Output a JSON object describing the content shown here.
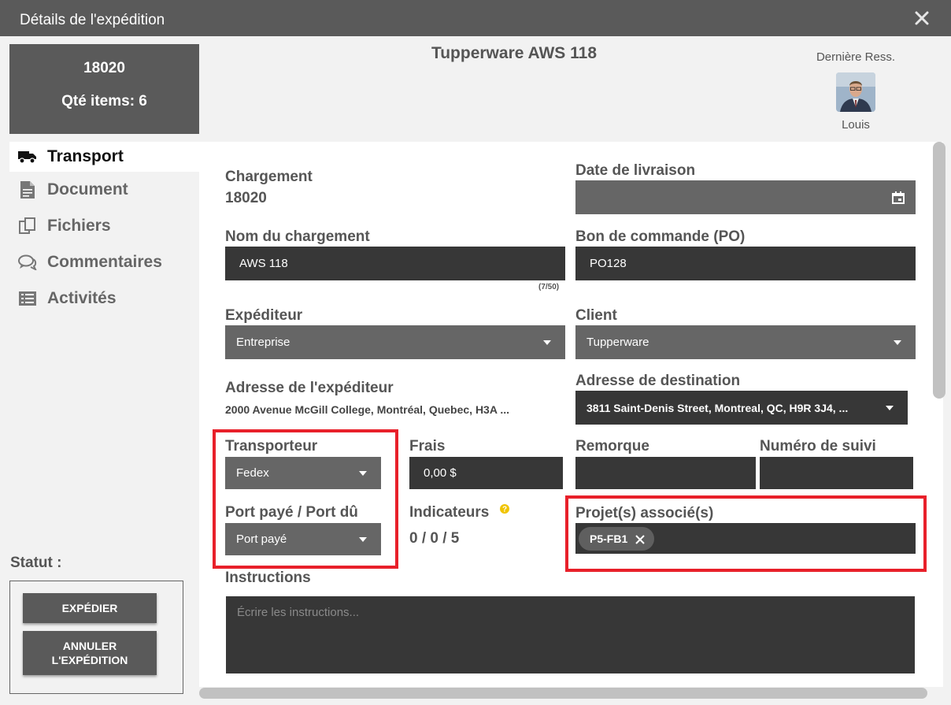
{
  "dialog": {
    "title": "Détails de l'expédition"
  },
  "summary": {
    "number": "18020",
    "qty": "Qté items: 6"
  },
  "header": {
    "title": "Tupperware AWS 118",
    "last_res_label": "Dernière Ress.",
    "last_res_name": "Louis"
  },
  "nav": {
    "transport": "Transport",
    "document": "Document",
    "fichiers": "Fichiers",
    "commentaires": "Commentaires",
    "activites": "Activités"
  },
  "status": {
    "label": "Statut :",
    "ship_button": "EXPÉDIER",
    "cancel_line1": "ANNULER",
    "cancel_line2": "L'EXPÉDITION"
  },
  "form": {
    "chargement_label": "Chargement",
    "chargement_value": "18020",
    "date_label": "Date de livraison",
    "date_value": "",
    "nom_label": "Nom du chargement",
    "nom_value": "AWS 118",
    "nom_counter": "(7/50)",
    "po_label": "Bon de commande (PO)",
    "po_value": "PO128",
    "expediteur_label": "Expéditeur",
    "expediteur_value": "Entreprise",
    "client_label": "Client",
    "client_value": "Tupperware",
    "adr_exp_label": "Adresse de l'expéditeur",
    "adr_exp_value": "2000 Avenue McGill College, Montréal, Quebec, H3A ...",
    "adr_dest_label": "Adresse de destination",
    "adr_dest_value": "3811 Saint-Denis Street, Montreal, QC, H9R 3J4, ...",
    "transporteur_label": "Transporteur",
    "transporteur_value": "Fedex",
    "frais_label": "Frais",
    "frais_value": "0,00 $",
    "remorque_label": "Remorque",
    "remorque_value": "",
    "suivi_label": "Numéro de suivi",
    "suivi_value": "",
    "port_label": "Port payé / Port dû",
    "port_value": "Port payé",
    "indicateurs_label": "Indicateurs",
    "indicateurs_value": "0 / 0 / 5",
    "projets_label": "Projet(s) associé(s)",
    "projet_chip": "P5-FB1",
    "instructions_label": "Instructions",
    "instructions_placeholder": "Écrire les instructions..."
  },
  "colors": {
    "highlight": "#e8202a",
    "help": "#f0c400",
    "field_dark": "#373737",
    "field_gray": "#666666"
  }
}
